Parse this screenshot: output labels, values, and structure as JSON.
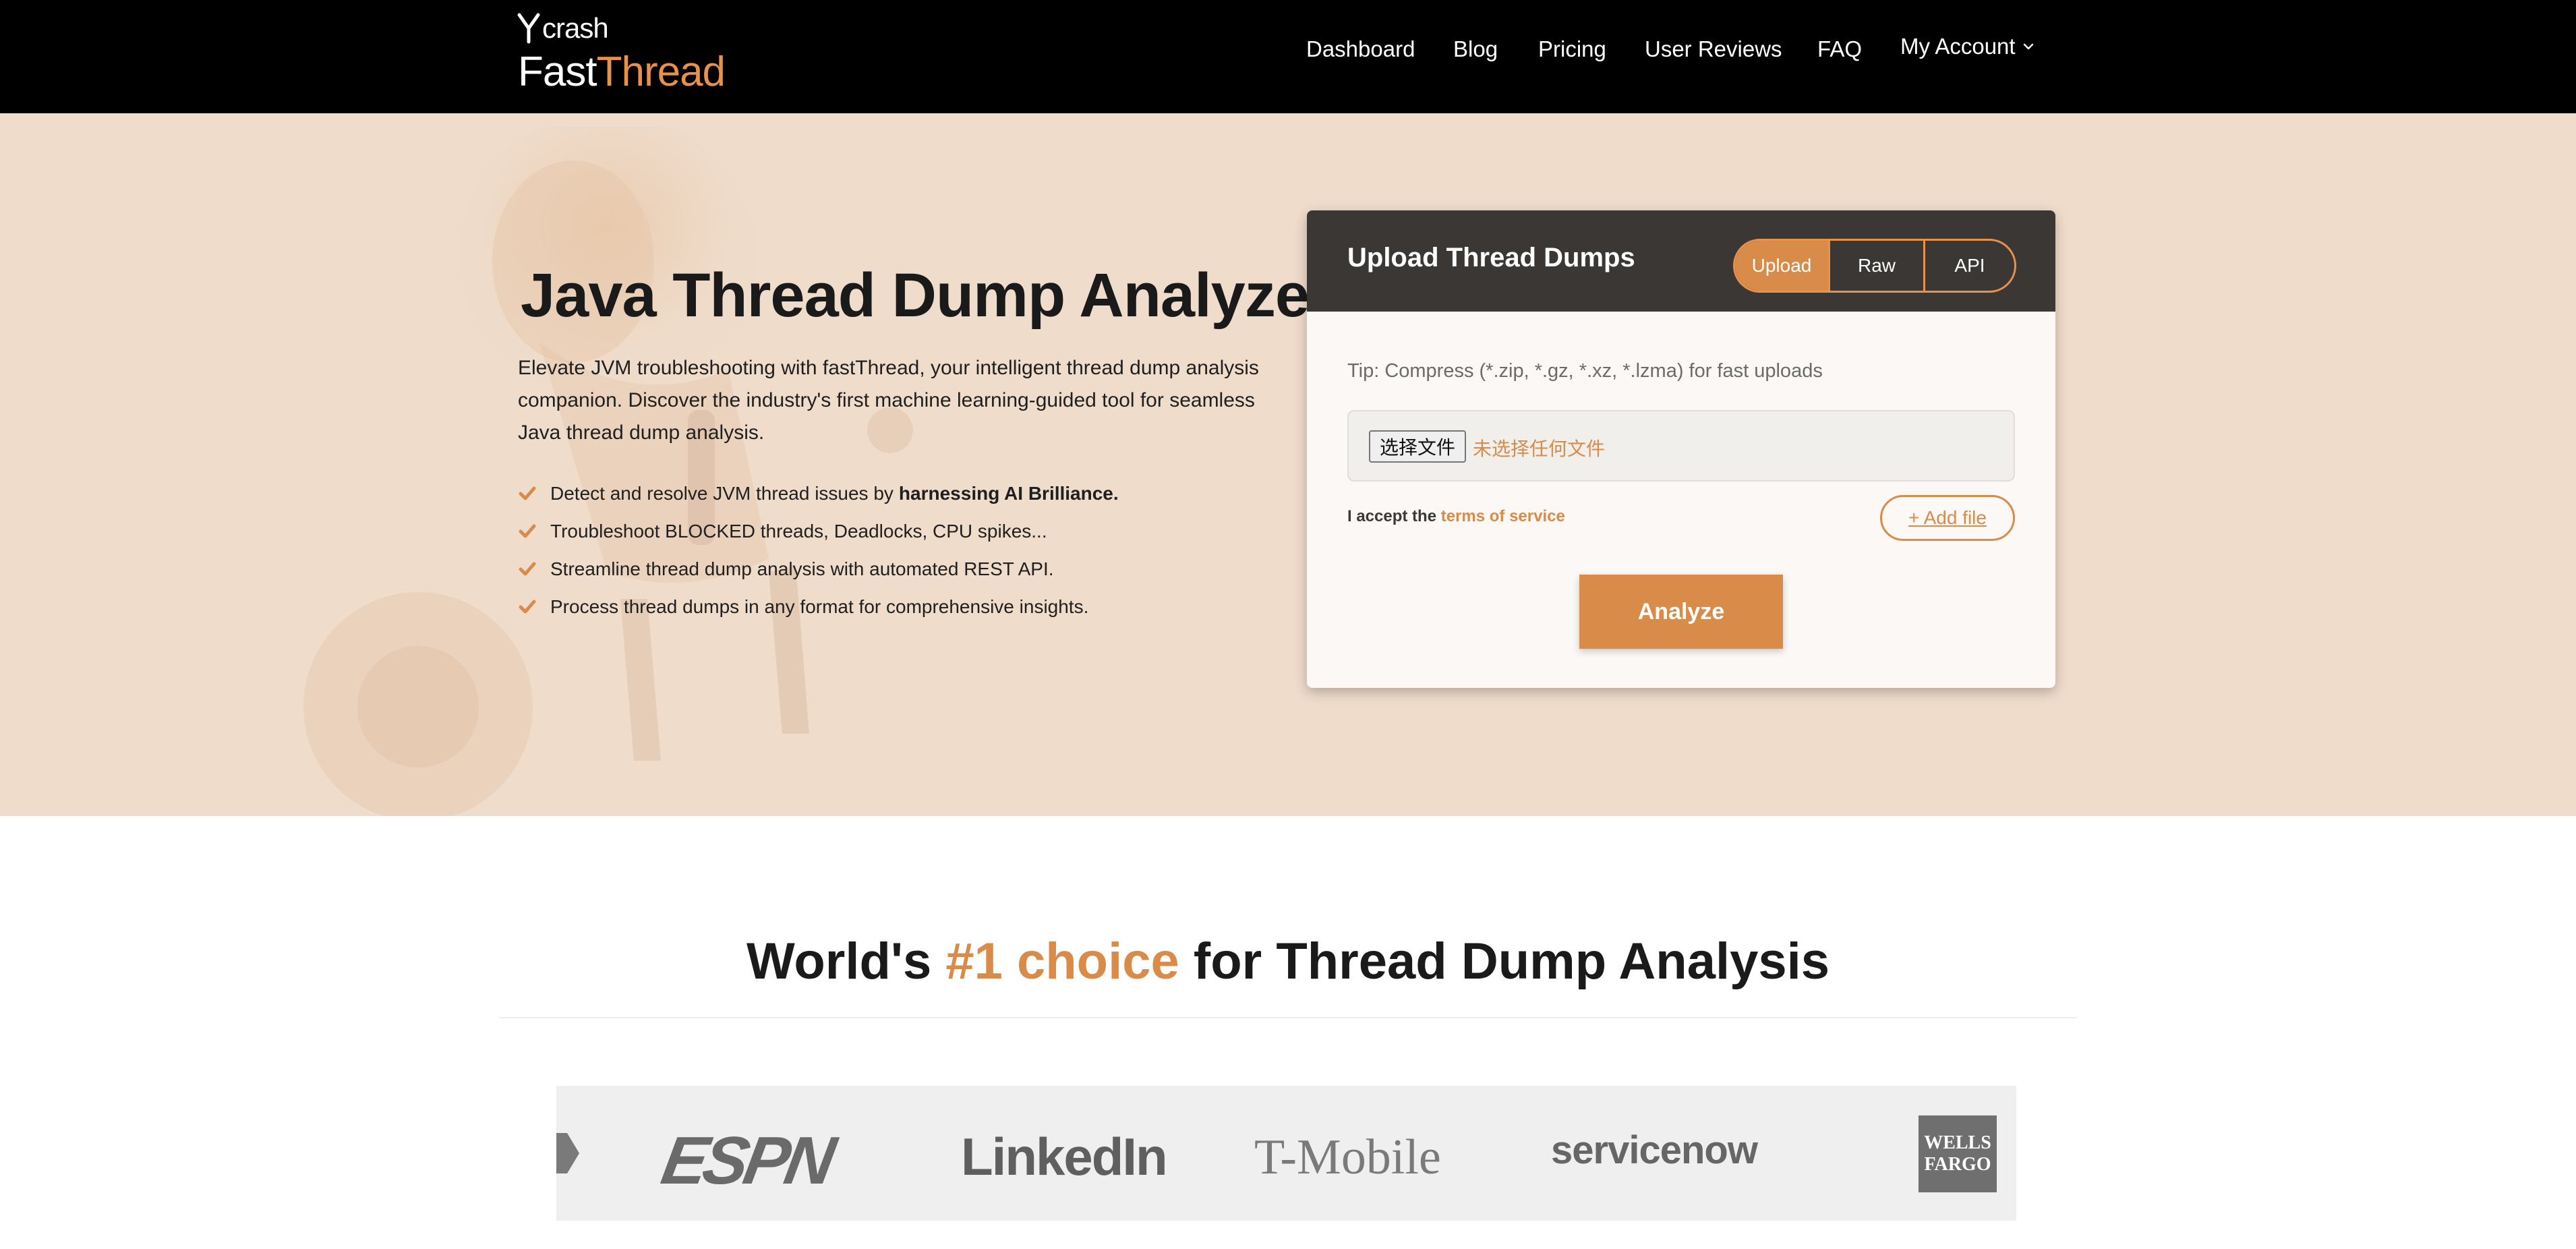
{
  "brand": {
    "small": "crash",
    "name_primary": "Fast",
    "name_accent": "Thread"
  },
  "nav": {
    "items": [
      "Dashboard",
      "Blog",
      "Pricing",
      "User Reviews",
      "FAQ"
    ],
    "account": "My Account"
  },
  "hero": {
    "title": "Java Thread Dump Analyzer",
    "description": "Elevate JVM troubleshooting with fastThread, your intelligent thread dump analysis companion. Discover the industry's first machine learning-guided tool for seamless Java thread dump analysis.",
    "features": [
      {
        "text": "Detect and resolve JVM thread issues by",
        "bold": "harnessing AI Brilliance."
      },
      {
        "text": "Troubleshoot BLOCKED threads, Deadlocks, CPU spikes...",
        "bold": ""
      },
      {
        "text": "Streamline thread dump analysis with automated REST API.",
        "bold": ""
      },
      {
        "text": "Process thread dumps in any format for comprehensive insights.",
        "bold": ""
      }
    ]
  },
  "upload": {
    "title": "Upload Thread Dumps",
    "tabs": [
      "Upload",
      "Raw",
      "API"
    ],
    "active_tab": "Upload",
    "tip": "Tip: Compress (*.zip, *.gz, *.xz, *.lzma) for fast uploads",
    "file_button": "选择文件",
    "file_status": "未选择任何文件",
    "terms_prefix": "I accept the",
    "terms_link": "terms of service",
    "add_file": "+ Add file",
    "analyze": "Analyze"
  },
  "choice": {
    "prefix": "World's",
    "accent": "#1 choice",
    "suffix": "for Thread Dump Analysis"
  },
  "customer_logos": [
    "ESPN",
    "LinkedIn",
    "T-Mobile",
    "servicenow",
    "WELLS FARGO"
  ],
  "colors": {
    "accent": "#d98b4a",
    "hero_bg": "#efdccb",
    "header_bg": "#000000",
    "card_head": "#3a3734"
  }
}
